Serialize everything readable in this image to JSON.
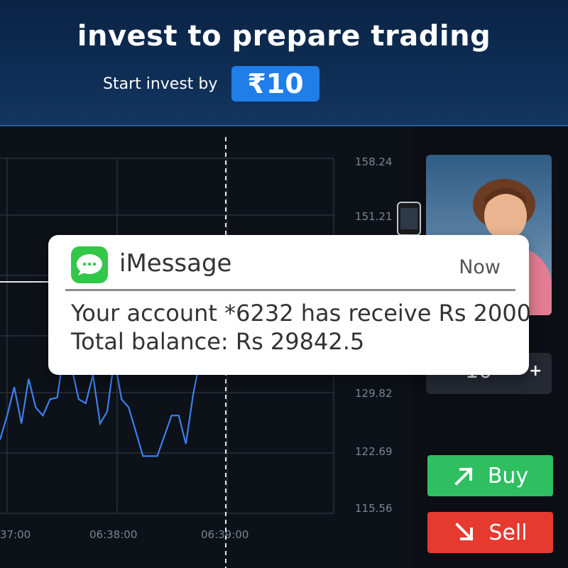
{
  "header": {
    "headline": "invest to prepare trading",
    "subline": "Start invest by",
    "min_amount": "₹10"
  },
  "chart": {
    "y_ticks": [
      "158.24",
      "151.21",
      "129.82",
      "122.69",
      "115.56"
    ],
    "x_ticks": [
      "37:00",
      "06:38:00",
      "06:39:00"
    ]
  },
  "chart_data": {
    "type": "line",
    "x_ticks": [
      "37:00",
      "06:38:00",
      "06:39:00"
    ],
    "y_ticks": [
      158.24,
      151.21,
      129.82,
      122.69,
      115.56
    ],
    "series": [
      {
        "values": [
          124.0,
          127.0,
          130.5,
          126.0,
          131.5,
          128.0,
          127.0,
          129.0,
          129.2,
          135.0,
          133.0,
          129.0,
          128.5,
          132.0,
          126.0,
          127.5,
          134.0,
          129.0,
          128.0,
          125.0,
          122.0,
          122.0,
          122.0,
          124.5,
          127.0,
          127.0,
          123.5,
          129.5,
          134.0,
          137.0
        ]
      }
    ],
    "grid": true
  },
  "notification": {
    "app_name": "iMessage",
    "time": "Now",
    "line1": "Your account *6232 has receive Rs 2000",
    "line2": "Total balance: Rs 29842.5"
  },
  "trade_panel": {
    "amount": "10",
    "plus_label": "+",
    "buy_label": "Buy",
    "sell_label": "Sell",
    "buy_color": "#2fbf61",
    "sell_color": "#e6392f"
  }
}
